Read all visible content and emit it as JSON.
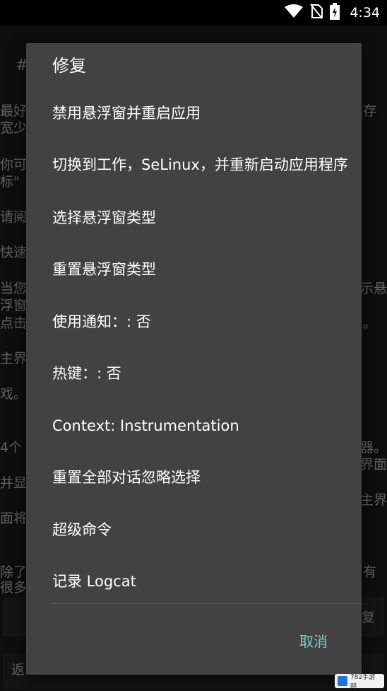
{
  "status_bar": {
    "time": "4:34",
    "icons": [
      "wifi-icon",
      "no-sim-icon",
      "battery-charging-icon"
    ]
  },
  "background": {
    "lines": [
      "#",
      "最好",
      "宽少",
      "你可",
      "标\"",
      "请阅",
      "快速",
      "当您",
      "浮窗",
      "点击",
      "主界",
      "戏。",
      "4个",
      "并显",
      "面将",
      "除了",
      "很多",
      "存",
      "示悬",
      "。",
      "器。",
      "界面",
      "主界",
      "有",
      "复",
      "返"
    ]
  },
  "dialog": {
    "title": "修复",
    "items": [
      "禁用悬浮窗并重启应用",
      "切换到工作，SeLinux，并重新启动应用程序",
      "选择悬浮窗类型",
      "重置悬浮窗类型",
      "使用通知：: 否",
      "热键：: 否",
      "Context: Instrumentation",
      "重置全部对话忽略选择",
      "超级命令",
      "记录 Logcat"
    ],
    "cancel_label": "取消"
  },
  "colors": {
    "dialog_bg": "#424242",
    "accent": "#80cbc4"
  },
  "watermark": {
    "text": "782手游网"
  }
}
